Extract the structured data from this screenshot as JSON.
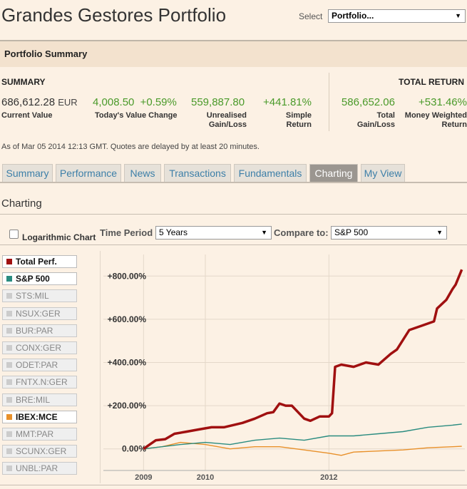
{
  "header": {
    "title": "Grandes Gestores Portfolio",
    "select_label": "Select",
    "select_value": "Portfolio..."
  },
  "section_title": "Portfolio Summary",
  "summary": {
    "heading": "SUMMARY",
    "total_return_heading": "TOTAL RETURN",
    "current_value": "686,612.28",
    "currency": "EUR",
    "current_value_label": "Current Value",
    "todays_change": "4,008.50",
    "todays_change_pct": "+0.59%",
    "todays_change_label": "Today's Value Change",
    "unrealised": "559,887.80",
    "unrealised_label_1": "Unrealised",
    "unrealised_label_2": "Gain/Loss",
    "simple_return": "+441.81%",
    "simple_return_label_1": "Simple",
    "simple_return_label_2": "Return",
    "total_gain": "586,652.06",
    "total_gain_label_1": "Total",
    "total_gain_label_2": "Gain/Loss",
    "mw_return": "+531.46%",
    "mw_return_label_1": "Money Weighted",
    "mw_return_label_2": "Return"
  },
  "as_of": "As of Mar 05 2014 12:13 GMT. Quotes are delayed by at least 20 minutes.",
  "tabs": [
    {
      "label": "Summary",
      "active": false
    },
    {
      "label": "Performance",
      "active": false
    },
    {
      "label": "News",
      "active": false
    },
    {
      "label": "Transactions",
      "active": false
    },
    {
      "label": "Fundamentals",
      "active": false
    },
    {
      "label": "Charting",
      "active": true
    },
    {
      "label": "My View",
      "active": false
    }
  ],
  "charting": {
    "heading": "Charting",
    "log_label": "Logarithmic Chart",
    "time_period_label": "Time Period",
    "time_period_value": "5 Years",
    "compare_label": "Compare to:",
    "compare_value": "S&P 500"
  },
  "legend": [
    {
      "label": "Total Perf.",
      "on": true,
      "color": "#a01010"
    },
    {
      "label": "S&P 500",
      "on": true,
      "color": "#2a8c80"
    },
    {
      "label": "STS:MIL",
      "on": false,
      "color": "#cccccc"
    },
    {
      "label": "NSUX:GER",
      "on": false,
      "color": "#cccccc"
    },
    {
      "label": "BUR:PAR",
      "on": false,
      "color": "#cccccc"
    },
    {
      "label": "CONX:GER",
      "on": false,
      "color": "#cccccc"
    },
    {
      "label": "ODET:PAR",
      "on": false,
      "color": "#cccccc"
    },
    {
      "label": "FNTX.N:GER",
      "on": false,
      "color": "#cccccc"
    },
    {
      "label": "BRE:MIL",
      "on": false,
      "color": "#cccccc"
    },
    {
      "label": "IBEX:MCE",
      "on": true,
      "color": "#e8902a"
    },
    {
      "label": "MMT:PAR",
      "on": false,
      "color": "#cccccc"
    },
    {
      "label": "SCUNX:GER",
      "on": false,
      "color": "#cccccc"
    },
    {
      "label": "UNBL:PAR",
      "on": false,
      "color": "#cccccc"
    }
  ],
  "chart_data": {
    "type": "line",
    "ylim": [
      -100,
      900
    ],
    "xlim": [
      2008.35,
      2014.2
    ],
    "y_ticks": [
      {
        "value": 0,
        "label": "0.00%"
      },
      {
        "value": 200,
        "label": "+200.00%"
      },
      {
        "value": 400,
        "label": "+400.00%"
      },
      {
        "value": 600,
        "label": "+600.00%"
      },
      {
        "value": 800,
        "label": "+800.00%"
      }
    ],
    "x_ticks": [
      {
        "value": 2009,
        "label": "2009"
      },
      {
        "value": 2010,
        "label": "2010"
      },
      {
        "value": 2012,
        "label": "2012"
      }
    ],
    "series": [
      {
        "name": "Total Perf.",
        "color": "#a01010",
        "x": [
          2009.0,
          2009.1,
          2009.2,
          2009.35,
          2009.5,
          2009.7,
          2009.9,
          2010.1,
          2010.3,
          2010.6,
          2010.8,
          2011.0,
          2011.1,
          2011.2,
          2011.3,
          2011.4,
          2011.5,
          2011.6,
          2011.7,
          2011.85,
          2012.0,
          2012.05,
          2012.1,
          2012.2,
          2012.4,
          2012.6,
          2012.8,
          2013.0,
          2013.1,
          2013.3,
          2013.5,
          2013.7,
          2013.75,
          2013.9,
          2014.0,
          2014.05,
          2014.15
        ],
        "y": [
          0,
          20,
          40,
          45,
          70,
          80,
          90,
          100,
          100,
          120,
          140,
          165,
          170,
          210,
          200,
          200,
          170,
          140,
          130,
          150,
          150,
          165,
          380,
          390,
          380,
          400,
          390,
          440,
          460,
          550,
          570,
          590,
          650,
          690,
          740,
          760,
          830
        ]
      },
      {
        "name": "S&P 500",
        "color": "#2a8c80",
        "x": [
          2009.0,
          2009.3,
          2009.6,
          2010.0,
          2010.4,
          2010.8,
          2011.2,
          2011.6,
          2012.0,
          2012.4,
          2012.8,
          2013.2,
          2013.6,
          2014.0,
          2014.15
        ],
        "y": [
          0,
          10,
          20,
          30,
          20,
          40,
          50,
          40,
          60,
          60,
          70,
          80,
          100,
          110,
          115
        ]
      },
      {
        "name": "IBEX:MCE",
        "color": "#e8902a",
        "x": [
          2009.0,
          2009.3,
          2009.6,
          2010.0,
          2010.4,
          2010.8,
          2011.2,
          2011.6,
          2012.0,
          2012.2,
          2012.4,
          2012.8,
          2013.2,
          2013.6,
          2014.0,
          2014.15
        ],
        "y": [
          0,
          10,
          30,
          20,
          0,
          10,
          10,
          -5,
          -20,
          -30,
          -15,
          -10,
          -5,
          5,
          10,
          12
        ]
      }
    ]
  }
}
